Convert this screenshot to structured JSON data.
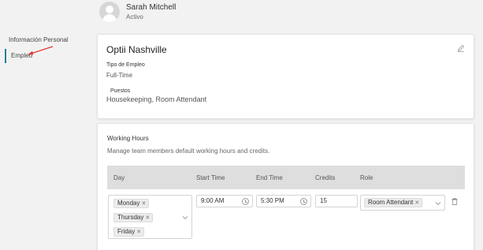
{
  "profile": {
    "name": "Sarah Mitchell",
    "status": "Activo"
  },
  "sidebar": {
    "items": [
      {
        "label": "Información Personal"
      },
      {
        "label": "Empleo"
      }
    ]
  },
  "employment": {
    "company": "Optii Nashville",
    "employment_type_label": "Tipo de Empleo",
    "employment_type_value": "Full-Time",
    "positions_label": "Puestos",
    "positions_value": "Housekeeping, Room Attendant"
  },
  "working_hours": {
    "title": "Working Hours",
    "description": "Manage team members default working hours and credits.",
    "columns": [
      "Day",
      "Start Time",
      "End Time",
      "Credits",
      "Role"
    ],
    "row": {
      "days": [
        "Monday",
        "Thursday",
        "Friday"
      ],
      "start_time": "9:00 AM",
      "end_time": "5:30 PM",
      "credits": "15",
      "role": "Room Attendant"
    }
  },
  "colors": {
    "accent": "#2b7ea1",
    "annotation_arrow": "#e53935",
    "header_bg": "#dedede"
  },
  "icons": [
    "avatar-icon",
    "pencil-icon",
    "clock-icon",
    "chevron-down-icon",
    "trash-icon",
    "arrow-annotation"
  ]
}
